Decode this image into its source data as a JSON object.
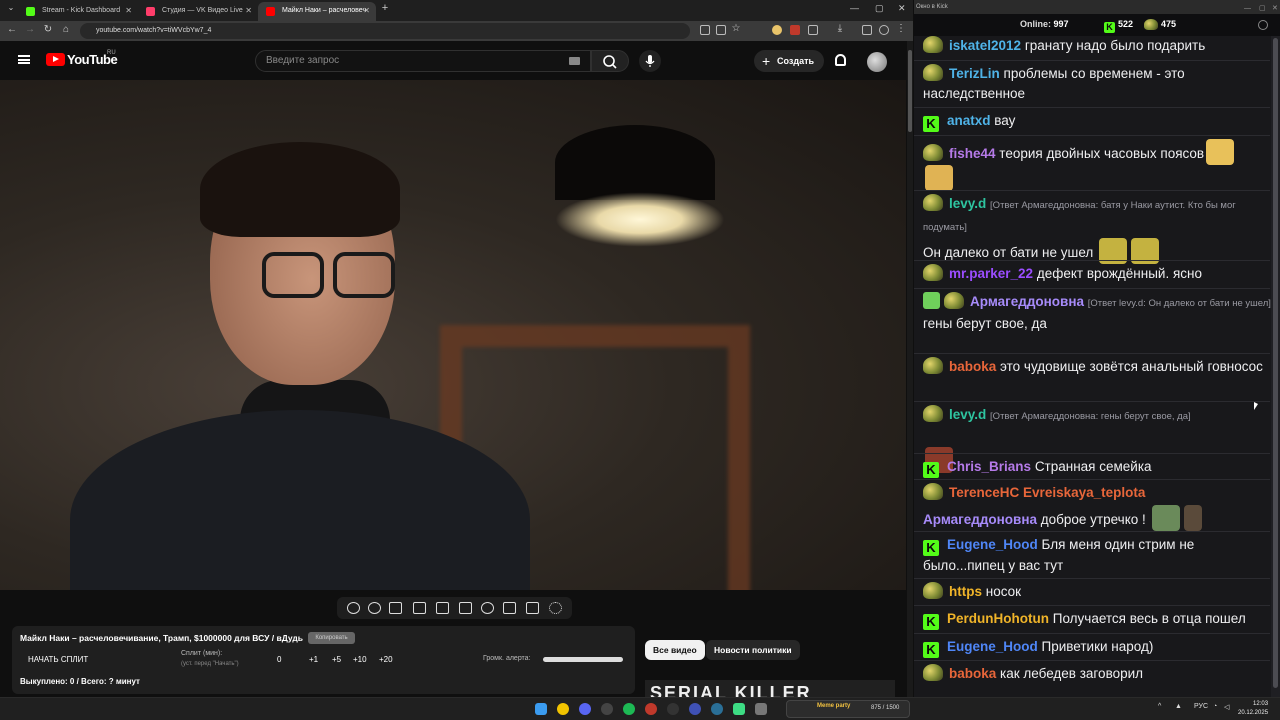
{
  "browser": {
    "tabs": [
      {
        "title": "Stream - Kick Dashboard",
        "color": "#53fc18",
        "active": false
      },
      {
        "title": "Студия — VK Видео Live",
        "color": "#ff3d6a",
        "active": false
      },
      {
        "title": "Майкл Наки – расчеловеч",
        "color": "#ff0000",
        "active": true
      }
    ],
    "new_tab": "+",
    "url": "youtube.com/watch?v=tiWVcbYw7_4"
  },
  "youtube": {
    "logo_text": "YouTube",
    "region": "RU",
    "search_placeholder": "Введите запрос",
    "create_label": "Создать"
  },
  "split_panel": {
    "video_title": "Майкл Наки – расчеловечивание, Трамп, $1000000 для ВСУ / вДудь",
    "copy_label": "Копировать",
    "start_label": "НАЧАТЬ СПЛИТ",
    "split_label": "Сплит (мин):",
    "split_hint": "(уст. перед \"Начать\")",
    "split_value": "0",
    "increments": [
      "+1",
      "+5",
      "+10",
      "+20"
    ],
    "volume_label": "Громк. алерта:",
    "volume_level": 1.0,
    "bought_label": "Выкуплено: 0 / Всего: ? минут"
  },
  "chips": {
    "all_videos": "Все видео",
    "politics": "Новости политики"
  },
  "thumbnail_text": "SERIAL KILLER",
  "chat": {
    "window_title": "Окно в Kick",
    "online_label": "Online:",
    "online_count": "997",
    "kick_count": "522",
    "other_count": "475",
    "messages": [
      {
        "user": "iskatel2012",
        "color": "#4fb3e8",
        "badge": "pepe",
        "text": "гранату надо было подарить"
      },
      {
        "user": "TerizLin",
        "color": "#4fb3e8",
        "badge": "pepe",
        "text": "проблемы со временем - это наследственное"
      },
      {
        "user": "anatxd",
        "color": "#4fb3e8",
        "badge": "kick",
        "text": "вау"
      },
      {
        "user": "fishe44",
        "color": "#b57ae8",
        "badge": "pepe",
        "text": "теория двойных часовых поясов"
      },
      {
        "user": "levy.d",
        "color": "#2ec4a0",
        "badge": "pepe",
        "reply": "[Ответ Армагеддоновна: батя у Наки аутист. Кто бы мог подумать]",
        "text": "Он далеко от бати не ушел"
      },
      {
        "user": "mr.parker_22",
        "color": "#9b4dff",
        "badge": "pepe",
        "text": "дефект врождённый. ясно"
      },
      {
        "user": "Армагеддоновна",
        "color": "#a78bfa",
        "badge": "shield",
        "reply": "[Ответ levy.d: Он далеко от бати не ушел]",
        "text": "гены берут свое, да"
      },
      {
        "user": "baboka",
        "color": "#e8663a",
        "badge": "pepe",
        "text": "это чудовище зовётся анальный говносос"
      },
      {
        "user": "levy.d",
        "color": "#2ec4a0",
        "badge": "pepe",
        "reply": "[Ответ Армагеддоновна: гены берут свое, да]",
        "text": ""
      },
      {
        "user": "Chris_Brians",
        "color": "#b57ae8",
        "badge": "kick",
        "text": "Странная семейка"
      },
      {
        "user": "TerenceHC",
        "color": "#e8663a",
        "badge": "pepe",
        "text": "Evreiskaya_teplota"
      },
      {
        "user": "Армагеддоновна",
        "color": "#a78bfa",
        "badge": "",
        "text": "доброе утречко !"
      },
      {
        "user": "Eugene_Hood",
        "color": "#4f86f7",
        "badge": "kick",
        "text": "Бля меня один стрим не было...пипец у вас тут"
      },
      {
        "user": "https",
        "color": "#f0b429",
        "badge": "pepe",
        "text": "носок"
      },
      {
        "user": "PerdunHohotun",
        "color": "#f0b429",
        "badge": "kick",
        "text": "Получается весь в отца пошел"
      },
      {
        "user": "Eugene_Hood",
        "color": "#4f86f7",
        "badge": "kick",
        "text": "Приветики народ)"
      },
      {
        "user": "baboka",
        "color": "#e8663a",
        "badge": "pepe",
        "text": "как лебедев заговорил"
      }
    ]
  },
  "taskbar": {
    "media_caption": "Meme party",
    "media_progress": "875 / 1500",
    "lang": "РУС",
    "time": "12:03",
    "date": "20.12.2025"
  }
}
